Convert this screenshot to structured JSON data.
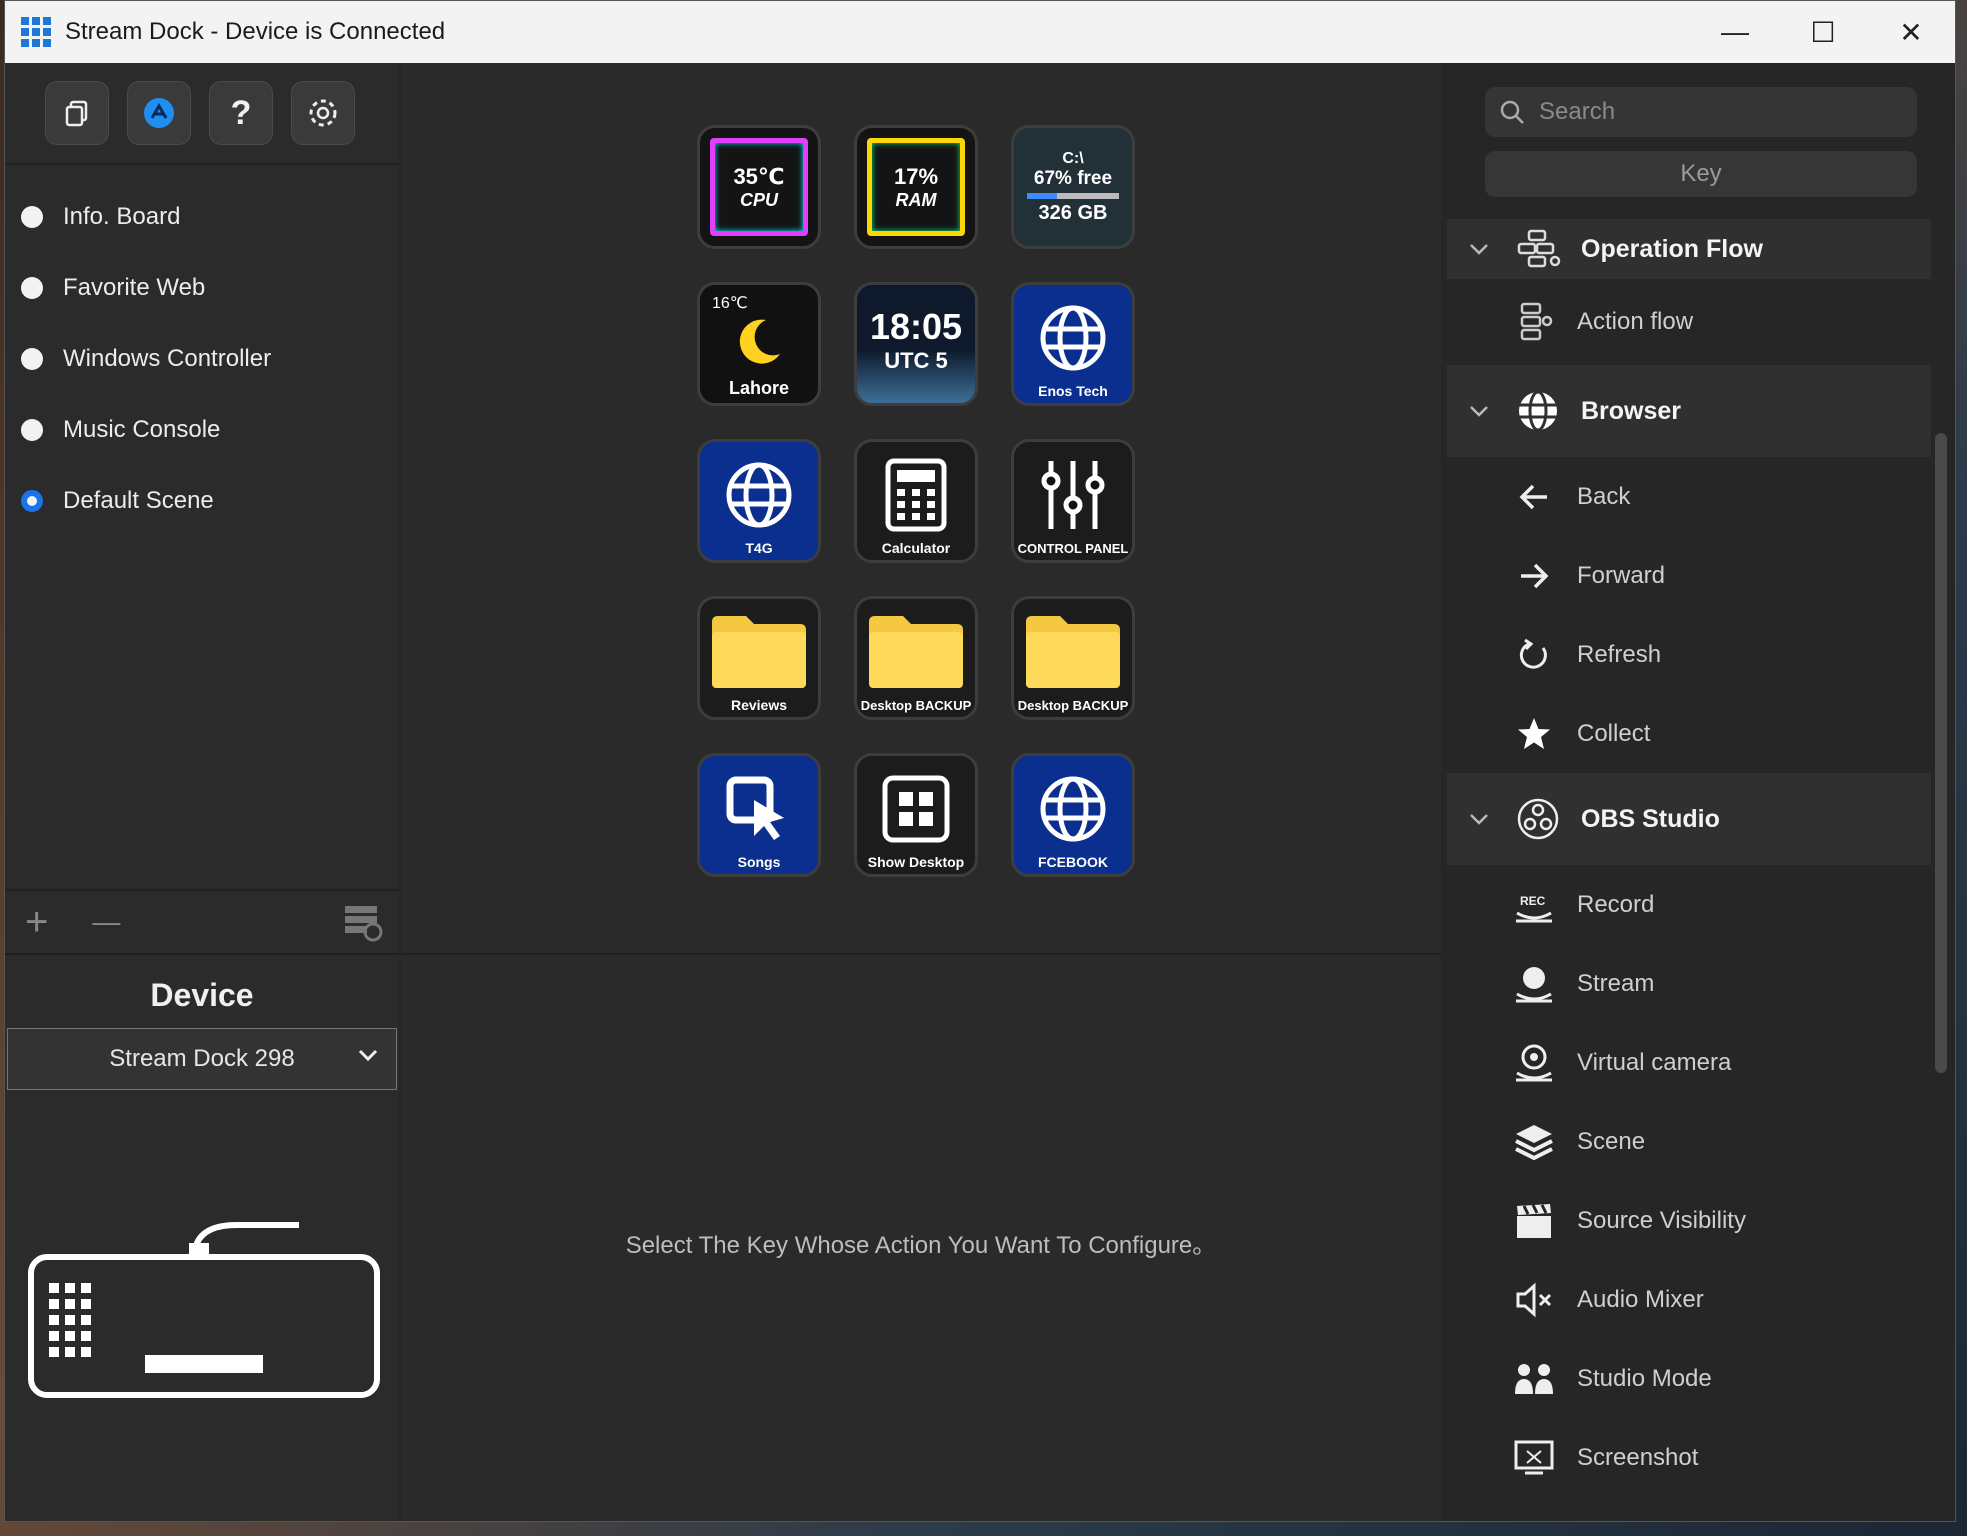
{
  "window": {
    "title": "Stream Dock - Device is Connected",
    "controls": [
      "—",
      "☐",
      "✕"
    ]
  },
  "toolbar": {
    "buttons": [
      "copy-icon",
      "store-icon",
      "help-icon",
      "gear-icon"
    ]
  },
  "scenes": [
    {
      "label": "Info. Board",
      "selected": false
    },
    {
      "label": "Favorite Web",
      "selected": false
    },
    {
      "label": "Windows Controller",
      "selected": false
    },
    {
      "label": "Music Console",
      "selected": false
    },
    {
      "label": "Default Scene",
      "selected": true
    }
  ],
  "scene_footer": {
    "add": "+",
    "remove": "—"
  },
  "device": {
    "title": "Device",
    "selected": "Stream Dock 298"
  },
  "keys": {
    "cpu": {
      "value": "35℃",
      "label": "CPU"
    },
    "ram": {
      "value": "17%",
      "label": "RAM"
    },
    "disk": {
      "drive": "C:\\",
      "free": "67% free",
      "size": "326 GB"
    },
    "weather": {
      "temp": "16℃",
      "label": "Lahore"
    },
    "clock": {
      "time": "18:05",
      "zone": "UTC 5"
    },
    "enos": {
      "label": "Enos Tech"
    },
    "t4g": {
      "label": "T4G"
    },
    "calculator": {
      "label": "Calculator"
    },
    "control": {
      "label": "CONTROL PANEL"
    },
    "reviews": {
      "label": "Reviews"
    },
    "backup1": {
      "label": "Desktop BACKUP"
    },
    "backup2": {
      "label": "Desktop BACKUP"
    },
    "songs": {
      "label": "Songs"
    },
    "showdesktop": {
      "label": "Show Desktop"
    },
    "facebook": {
      "label": "FCEBOOK"
    }
  },
  "hint": "Select The Key Whose Action You Want To Configure。",
  "right_panel": {
    "search_placeholder": "Search",
    "tab": "Key",
    "groups": [
      {
        "name": "Operation Flow",
        "actions": [
          "Action flow"
        ]
      },
      {
        "name": "Browser",
        "actions": [
          "Back",
          "Forward",
          "Refresh",
          "Collect"
        ]
      },
      {
        "name": "OBS Studio",
        "actions": [
          "Record",
          "Stream",
          "Virtual camera",
          "Scene",
          "Source Visibility",
          "Audio Mixer",
          "Studio Mode",
          "Screenshot"
        ]
      }
    ]
  },
  "colors": {
    "accent": "#1a73e8",
    "key_blue": "#0a2f8f",
    "folder": "#f5c842"
  }
}
